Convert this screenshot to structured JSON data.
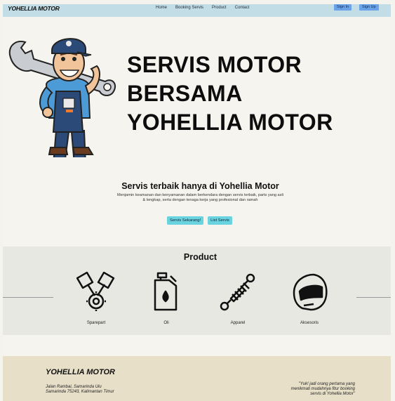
{
  "nav": {
    "brand": "YOHELLIA MOTOR",
    "links": [
      "Home",
      "Booking Servis",
      "Product",
      "Contact"
    ],
    "sign_in": "Sign In",
    "sign_up": "Sign Up"
  },
  "hero": {
    "title_lines": [
      "SERVIS MOTOR",
      "BERSAMA",
      "YOHELLIA MOTOR"
    ]
  },
  "tagline": {
    "heading": "Servis terbaik hanya di Yohellia Motor",
    "description": "Menjamin keamanan dan kenyamanan dalam berkendara dengan servis terbaik, parts yang asli & lengkap, serta dengan tenaga kerja yang profesional dan ramah",
    "cta_primary": "Servis Sekarang!",
    "cta_secondary": "List Servis"
  },
  "products": {
    "title": "Product",
    "items": [
      {
        "label": "Sparepart",
        "icon": "pistons-icon"
      },
      {
        "label": "Oli",
        "icon": "oil-can-icon"
      },
      {
        "label": "Apparel",
        "icon": "shock-absorber-icon"
      },
      {
        "label": "Aksesoris",
        "icon": "helmet-icon"
      }
    ]
  },
  "footer": {
    "brand": "YOHELLIA MOTOR",
    "address_lines": [
      "Jalan Rambai, Samarinda Ulu",
      "Samarinda 75243, Kalimantan Timur"
    ],
    "quote_lines": [
      "\"Yuk! jadi orang pertama yang",
      "menikmati mudahnya fitur booking",
      "servis di Yohellia Motor\""
    ]
  },
  "colors": {
    "navbar": "#c3dde6",
    "button": "#6aa3e8",
    "cta": "#69d3e0",
    "products_bg": "#e8e8e2",
    "footer_bg": "#e7dfc8"
  }
}
